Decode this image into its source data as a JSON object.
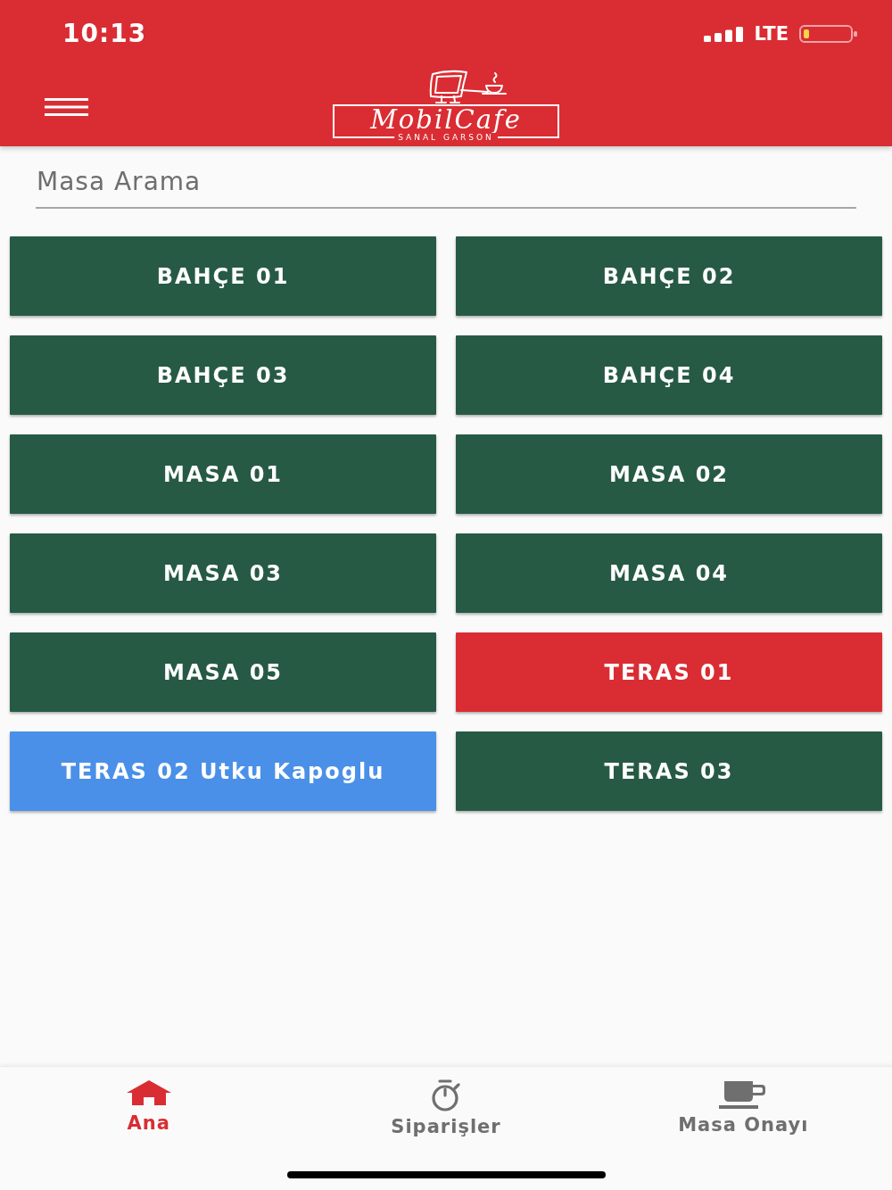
{
  "status_bar": {
    "time": "10:13",
    "network": "LTE"
  },
  "header": {
    "logo_title": "MobilCafe",
    "logo_subtitle": "SANAL GARSON"
  },
  "search": {
    "placeholder": "Masa Arama"
  },
  "tables": [
    {
      "label": "BAHÇE 01",
      "color": "#265a44"
    },
    {
      "label": "BAHÇE 02",
      "color": "#265a44"
    },
    {
      "label": "BAHÇE 03",
      "color": "#265a44"
    },
    {
      "label": "BAHÇE 04",
      "color": "#265a44"
    },
    {
      "label": "MASA 01",
      "color": "#265a44"
    },
    {
      "label": "MASA 02",
      "color": "#265a44"
    },
    {
      "label": "MASA 03",
      "color": "#265a44"
    },
    {
      "label": "MASA 04",
      "color": "#265a44"
    },
    {
      "label": "MASA 05",
      "color": "#265a44"
    },
    {
      "label": "TERAS 01",
      "color": "#d92d33"
    },
    {
      "label": "TERAS 02 Utku Kapoglu",
      "color": "#4a90e8"
    },
    {
      "label": "TERAS 03",
      "color": "#265a44"
    }
  ],
  "bottom_nav": [
    {
      "label": "Ana",
      "kind": "home",
      "selected": true
    },
    {
      "label": "Siparişler",
      "kind": "stopwatch",
      "selected": false
    },
    {
      "label": "Masa Onayı",
      "kind": "cup",
      "selected": false
    }
  ]
}
